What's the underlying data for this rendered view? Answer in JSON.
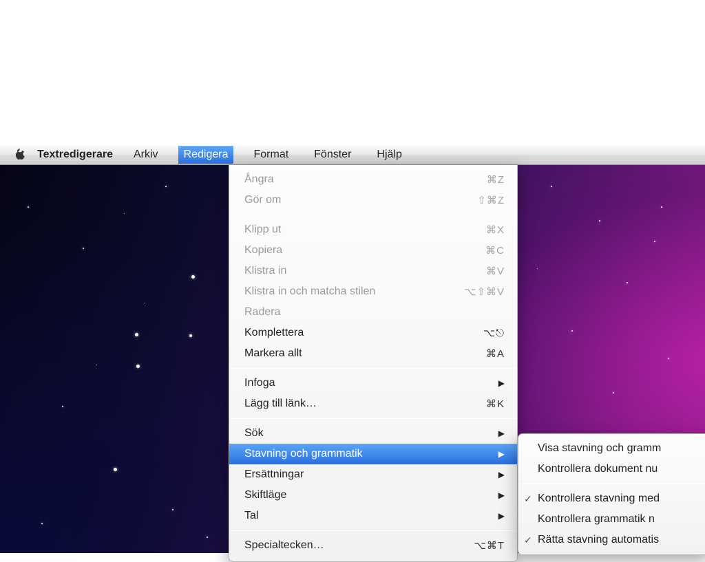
{
  "menubar": {
    "app_name": "Textredigerare",
    "items": [
      {
        "label": "Arkiv"
      },
      {
        "label": "Redigera",
        "active": true
      },
      {
        "label": "Format"
      },
      {
        "label": "Fönster"
      },
      {
        "label": "Hjälp"
      }
    ]
  },
  "redigera_menu": {
    "groups": [
      [
        {
          "label": "Ångra",
          "shortcut": "⌘Z",
          "disabled": true
        },
        {
          "label": "Gör om",
          "shortcut": "⇧⌘Z",
          "disabled": true
        }
      ],
      [
        {
          "label": "Klipp ut",
          "shortcut": "⌘X",
          "disabled": true
        },
        {
          "label": "Kopiera",
          "shortcut": "⌘C",
          "disabled": true
        },
        {
          "label": "Klistra in",
          "shortcut": "⌘V",
          "disabled": true
        },
        {
          "label": "Klistra in och matcha stilen",
          "shortcut": "⌥⇧⌘V",
          "disabled": true
        },
        {
          "label": "Radera",
          "shortcut": "",
          "disabled": true
        },
        {
          "label": "Komplettera",
          "shortcut": "⌥⎋",
          "disabled": false
        },
        {
          "label": "Markera allt",
          "shortcut": "⌘A",
          "disabled": false
        }
      ],
      [
        {
          "label": "Infoga",
          "submenu": true
        },
        {
          "label": "Lägg till länk…",
          "shortcut": "⌘K"
        }
      ],
      [
        {
          "label": "Sök",
          "submenu": true
        },
        {
          "label": "Stavning och grammatik",
          "submenu": true,
          "highlight": true
        },
        {
          "label": "Ersättningar",
          "submenu": true
        },
        {
          "label": "Skiftläge",
          "submenu": true
        },
        {
          "label": "Tal",
          "submenu": true
        }
      ],
      [
        {
          "label": "Specialtecken…",
          "shortcut": "⌥⌘T"
        }
      ]
    ]
  },
  "spelling_submenu": {
    "groups": [
      [
        {
          "label": "Visa stavning och gramm"
        },
        {
          "label": "Kontrollera dokument nu"
        }
      ],
      [
        {
          "label": "Kontrollera stavning med",
          "checked": true
        },
        {
          "label": "Kontrollera grammatik n"
        },
        {
          "label": "Rätta stavning automatis",
          "checked": true
        }
      ]
    ]
  }
}
